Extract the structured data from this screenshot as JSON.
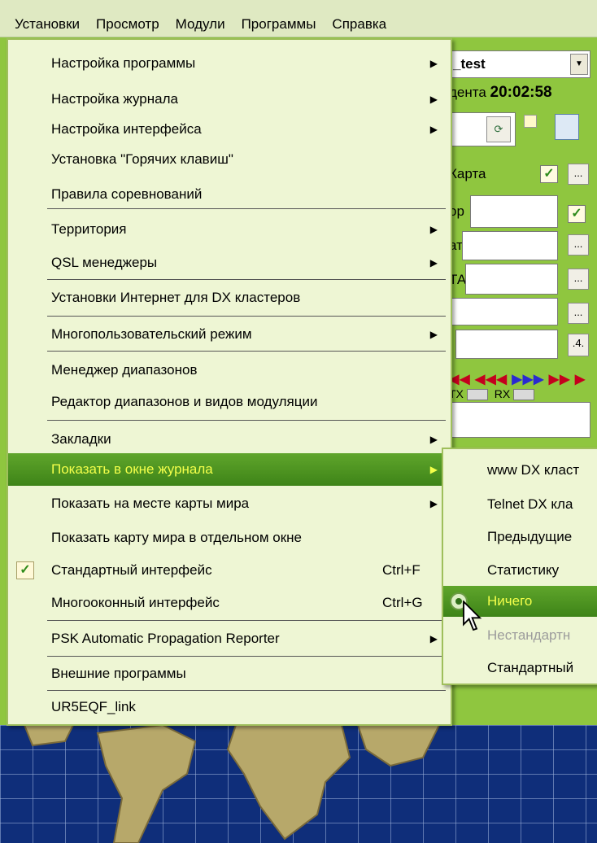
{
  "menubar": {
    "items": [
      "Установки",
      "Просмотр",
      "Модули",
      "Программы",
      "Справка"
    ]
  },
  "background": {
    "combo_value": "_test",
    "time_label": "дента",
    "time_value": "20:02:58",
    "map_label": "Карта",
    "field_labels": [
      "ор",
      "ат",
      "ТА"
    ],
    "button_ellipsis": "...",
    "button_4": ".4.",
    "tx_label": "TX",
    "rx_label": "RX"
  },
  "main_menu": {
    "items": [
      {
        "label": "Настройка программы",
        "submenu": true
      },
      {
        "label": "Настройка журнала",
        "submenu": true
      },
      {
        "label": "Настройка интерфейса",
        "submenu": true
      },
      {
        "label": "Установка \"Горячих клавиш\""
      },
      {
        "label": "Правила соревнований"
      },
      {
        "label": "Территория",
        "submenu": true
      },
      {
        "label": "QSL менеджеры",
        "submenu": true
      },
      {
        "label": "Установки Интернет для DX кластеров"
      },
      {
        "label": "Многопользовательский режим",
        "submenu": true
      },
      {
        "label": "Менеджер диапазонов"
      },
      {
        "label": "Редактор диапазонов и видов модуляции"
      },
      {
        "label": "Закладки",
        "submenu": true
      },
      {
        "label": "Показать в окне журнала",
        "submenu": true,
        "selected": true
      },
      {
        "label": "Показать на месте карты мира",
        "submenu": true
      },
      {
        "label": "Показать карту мира в отдельном окне"
      },
      {
        "label": "Стандартный интерфейс",
        "shortcut": "Ctrl+F",
        "checked": true
      },
      {
        "label": "Многооконный интерфейс",
        "shortcut": "Ctrl+G"
      },
      {
        "label": "PSK Automatic Propagation Reporter",
        "submenu": true
      },
      {
        "label": "Внешние программы"
      },
      {
        "label": "UR5EQF_link"
      }
    ]
  },
  "sub_menu": {
    "items": [
      {
        "label": "www DX класт"
      },
      {
        "label": "Telnet DX кла"
      },
      {
        "label": "Предыдущие"
      },
      {
        "label": "Статистику"
      },
      {
        "label": "Ничего",
        "selected": true,
        "radio": true
      },
      {
        "label": "Нестандартн",
        "disabled": true
      },
      {
        "label": "Стандартный"
      }
    ]
  },
  "colors": {
    "menu_background": "#eef6d4",
    "selection_green": "#4e9522",
    "selection_text": "#f3ff4a",
    "app_green": "#8fc63f",
    "map_blue": "#0f2e7a"
  }
}
